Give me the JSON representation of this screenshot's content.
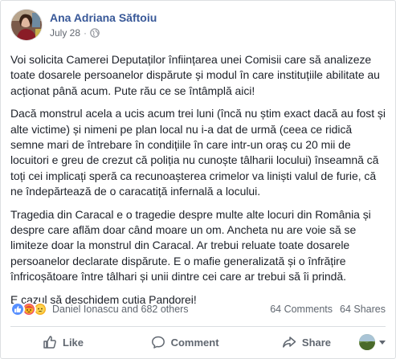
{
  "post": {
    "author": "Ana Adriana Săftoiu",
    "date": "July 28",
    "separator": "·",
    "paragraphs": [
      "Voi solicita Camerei Deputaților înființarea unei Comisii care să analizeze toate dosarele persoanelor dispărute și modul în care instituțiile abilitate au acționat până acum. Pute rău ce se întâmplă aici!",
      "Dacă monstrul acela a ucis acum trei luni (încă nu știm exact dacă au fost și alte victime) și nimeni pe plan local nu i-a dat de urmă (ceea ce ridică semne mari de întrebare în condițiile în care intr-un oraș cu 20 mii de locuitori e greu de crezut că poliția nu cunoște tâlharii locului) înseamnă că toți cei implicați speră ca recunoașterea crimelor va liniști valul de furie, că ne îndepărtează de o caracatiță infernală a locului.",
      "Tragedia din Caracal e o tragedie despre multe alte locuri din România și despre care aflăm doar când moare un om. Ancheta nu are voie să se limiteze doar la monstrul din Caracal. Ar trebui reluate toate dosarele persoanelor declarate dispărute. E o mafie generalizată și o înfrățire înfricoșătoare între tâlhari și unii dintre cei care ar trebui să îi prindă.",
      "E cazul să deschidem cutia Pandorei!"
    ]
  },
  "stats": {
    "reaction_icons": [
      "like-icon",
      "angry-icon",
      "sad-icon"
    ],
    "reactors": "Daniel Ionascu and 682 others",
    "comments": "64 Comments",
    "shares": "64 Shares"
  },
  "actions": {
    "like": "Like",
    "comment": "Comment",
    "share": "Share"
  },
  "colors": {
    "name": "#385898",
    "like_reaction": "#5890ff",
    "angry_reaction": "#f25268",
    "sad_reaction": "#f7b125",
    "action_text": "#606770"
  }
}
